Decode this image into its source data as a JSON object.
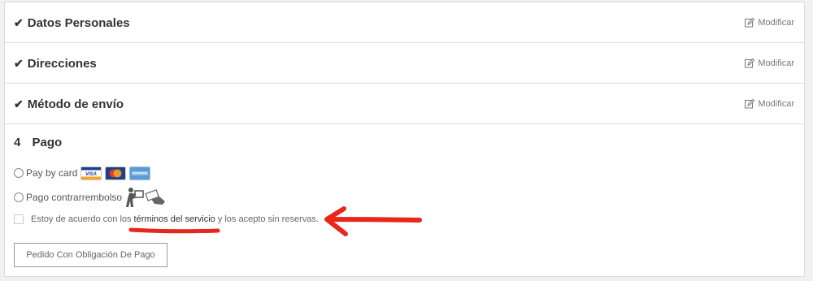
{
  "steps": [
    {
      "label": "Datos Personales",
      "action": "Modificar"
    },
    {
      "label": "Direcciones",
      "action": "Modificar"
    },
    {
      "label": "Método de envío",
      "action": "Modificar"
    }
  ],
  "payment": {
    "number": "4",
    "title": "Pago",
    "options": [
      {
        "label": "Pay by card",
        "icons": [
          "visa-card",
          "mastercard-card",
          "amex-card"
        ]
      },
      {
        "label": "Pago contrarrembolso",
        "icons": [
          "courier-icon",
          "cash-hand-icon"
        ]
      }
    ],
    "terms": {
      "prefix": "Estoy de acuerdo con los",
      "link": "términos del servicio",
      "suffix": "y los acepto sin reservas."
    },
    "submit_label": "Pedido Con Obligación De Pago"
  },
  "colors": {
    "annotation_red": "#e8261c",
    "visa_blue": "#1a3d8f",
    "mastercard_red": "#e23a2d",
    "mastercard_orange": "#f5a623",
    "amex_blue": "#5b9bd5"
  }
}
